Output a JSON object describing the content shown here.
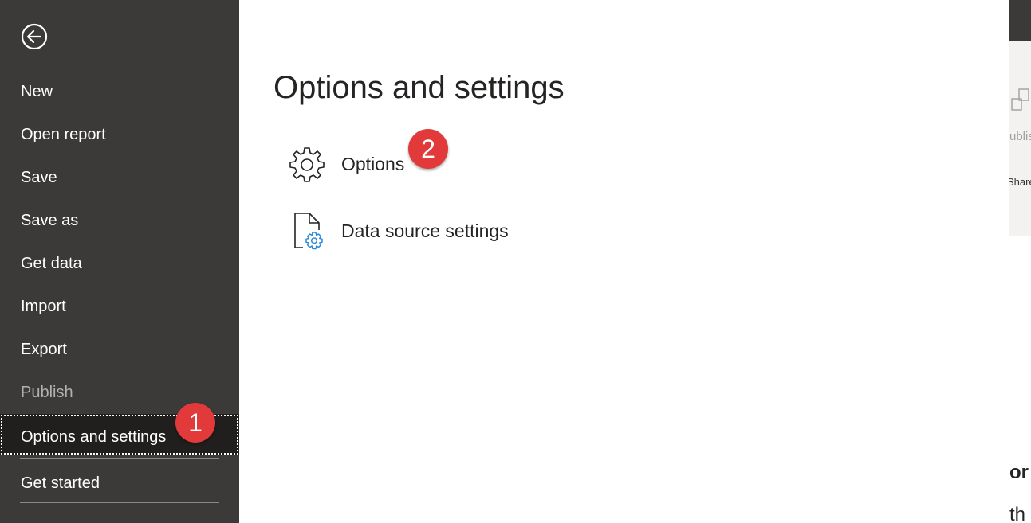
{
  "sidebar": {
    "back_icon": "back-arrow-icon",
    "items": [
      {
        "label": "New"
      },
      {
        "label": "Open report"
      },
      {
        "label": "Save"
      },
      {
        "label": "Save as"
      },
      {
        "label": "Get data"
      },
      {
        "label": "Import"
      },
      {
        "label": "Export"
      },
      {
        "label": "Publish",
        "disabled": true
      },
      {
        "label": "Options and settings",
        "selected": true
      },
      {
        "label": "Get started"
      }
    ]
  },
  "main": {
    "title": "Options and settings",
    "items": [
      {
        "label": "Options",
        "icon": "gear-icon"
      },
      {
        "label": "Data source settings",
        "icon": "data-source-settings-icon"
      }
    ]
  },
  "badges": {
    "step1": "1",
    "step2": "2"
  },
  "ribbon_peek": {
    "publish_fragment": "ublis",
    "share_fragment": "Share"
  },
  "canvas_peek": {
    "heading_fragment": "or",
    "text_fragment": "th"
  },
  "colors": {
    "sidebar_bg": "#3b3a39",
    "selected_bg": "#201f1e",
    "badge": "#e23a3a",
    "accent_icon": "#2b88d8"
  }
}
